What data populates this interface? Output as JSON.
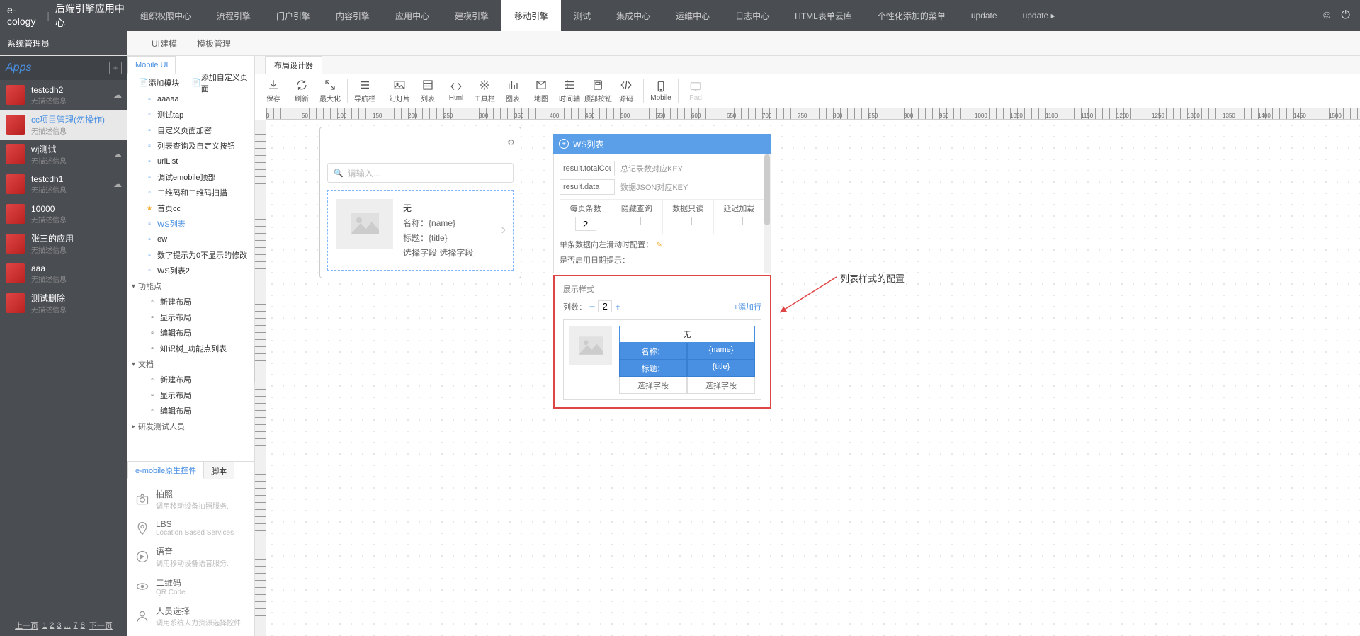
{
  "header": {
    "brand": "e-cology",
    "subtitle": "后端引擎应用中心",
    "nav": [
      "组织权限中心",
      "流程引擎",
      "门户引擎",
      "内容引擎",
      "应用中心",
      "建模引擎",
      "移动引擎",
      "测试",
      "集成中心",
      "运维中心",
      "日志中心",
      "HTML表单云库",
      "个性化添加的菜单",
      "update",
      "update ▸"
    ],
    "nav_active_index": 6
  },
  "subheader": {
    "left": "系统管理员",
    "tabs": [
      "UI建模",
      "模板管理"
    ]
  },
  "apps": {
    "title": "Apps",
    "items": [
      {
        "name": "testcdh2",
        "desc": "无描述信息",
        "cloud": true
      },
      {
        "name": "cc项目管理(勿操作)",
        "desc": "无描述信息",
        "cloud": false,
        "active": true
      },
      {
        "name": "wj测试",
        "desc": "无描述信息",
        "cloud": true
      },
      {
        "name": "testcdh1",
        "desc": "无描述信息",
        "cloud": true
      },
      {
        "name": "10000",
        "desc": "无描述信息",
        "cloud": false
      },
      {
        "name": "张三的应用",
        "desc": "无描述信息",
        "cloud": false
      },
      {
        "name": "aaa",
        "desc": "无描述信息",
        "cloud": false
      },
      {
        "name": "测试删除",
        "desc": "无描述信息",
        "cloud": false
      }
    ],
    "pagination": {
      "prev": "上一页",
      "pages": [
        "1",
        "2",
        "3",
        "...",
        "7",
        "8"
      ],
      "next": "下一页"
    }
  },
  "tree": {
    "tab": "Mobile UI",
    "toolbar": [
      "添加模块",
      "添加自定义页面"
    ],
    "pages": [
      "aaaaa",
      "测试tap",
      "自定义页面加密",
      "列表查询及自定义按钮",
      "urlList",
      "调试emobile顶部",
      "二维码和二维码扫描"
    ],
    "star_page": "首页cc",
    "active_page": "WS列表",
    "pages_after": [
      "ew",
      "数字提示为0不显示的修改",
      "WS列表2"
    ],
    "groups": [
      {
        "name": "功能点",
        "children": [
          "新建布局",
          "显示布局",
          "编辑布局",
          "知识树_功能点列表"
        ]
      },
      {
        "name": "文档",
        "children": [
          "新建布局",
          "显示布局",
          "编辑布局"
        ]
      },
      {
        "name": "研发测试人员",
        "children": []
      }
    ],
    "controls_tab_active": "e-mobile原生控件",
    "controls_tab_other": "脚本",
    "controls": [
      {
        "name": "拍照",
        "desc": "调用移动设备拍照服务."
      },
      {
        "name": "LBS",
        "desc": "Location Based Services"
      },
      {
        "name": "语音",
        "desc": "调用移动设备语音服务."
      },
      {
        "name": "二维码",
        "desc": "QR Code"
      },
      {
        "name": "人员选择",
        "desc": "调用系统人力资源选择控件."
      }
    ]
  },
  "editor": {
    "tab": "布局设计器",
    "toolbar": [
      "保存",
      "刷新",
      "最大化",
      "导航栏",
      "幻灯片",
      "列表",
      "Html",
      "工具栏",
      "图表",
      "地图",
      "时间轴",
      "顶部按钮",
      "源码",
      "Mobile",
      "Pad"
    ]
  },
  "phone": {
    "search_placeholder": "请输入...",
    "card": {
      "title": "无",
      "rows": [
        {
          "label": "名称：",
          "value": "{name}"
        },
        {
          "label": "标题：",
          "value": "{title}"
        },
        {
          "label": "选择字段",
          "value": "选择字段"
        }
      ]
    }
  },
  "props": {
    "title": "WS列表",
    "key1": {
      "value": "result.totalCoun",
      "label": "总记录数对应KEY"
    },
    "key2": {
      "value": "result.data",
      "label": "数据JSON对应KEY"
    },
    "grid_headers": [
      "每页条数",
      "隐藏查询",
      "数据只读",
      "延迟加载"
    ],
    "per_page_value": "2",
    "line1": "单条数据向左滑动时配置：",
    "line2": "是否启用日期提示：",
    "style": {
      "title": "展示样式",
      "cols_label": "列数：",
      "cols_value": "2",
      "add_row": "添加行",
      "head": "无",
      "cells": [
        [
          "名称：",
          "{name}"
        ],
        [
          "标题：",
          "{title}"
        ],
        [
          "选择字段",
          "选择字段"
        ]
      ]
    }
  },
  "annotation": "列表样式的配置"
}
